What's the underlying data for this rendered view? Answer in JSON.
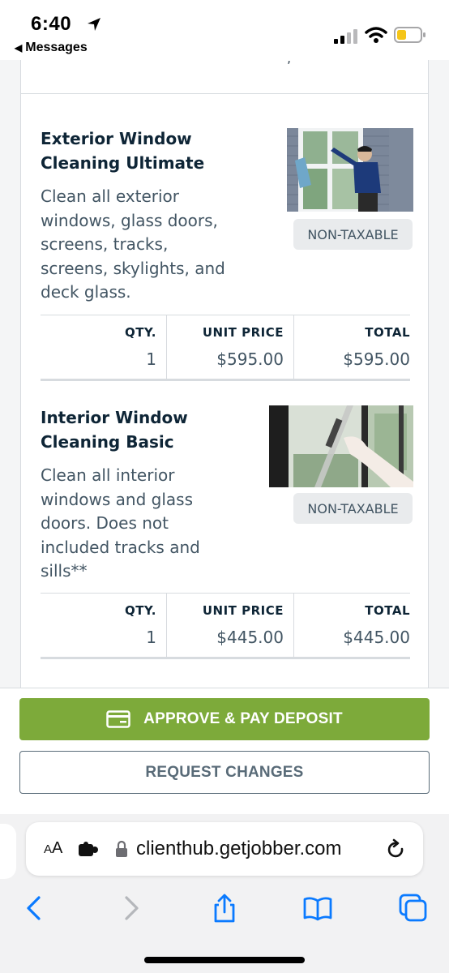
{
  "status_bar": {
    "time": "6:40",
    "back_app": "Messages"
  },
  "line_items": [
    {
      "title": "Exterior Window Cleaning Ultimate",
      "description": "Clean all exterior windows, glass doors, screens, tracks, screens, skylights, and deck glass.",
      "tax_status": "NON-TAXABLE",
      "qty": "1",
      "unit_price": "$595.00",
      "total": "$595.00"
    },
    {
      "title": "Interior Window Cleaning Basic",
      "description": "Clean all interior windows and glass doors. Does not included tracks and sills**",
      "tax_status": "NON-TAXABLE",
      "qty": "1",
      "unit_price": "$445.00",
      "total": "$445.00"
    }
  ],
  "table_headers": {
    "qty": "QTY.",
    "unit_price": "UNIT PRICE",
    "total": "TOTAL"
  },
  "actions": {
    "approve_label": "APPROVE & PAY DEPOSIT",
    "request_label": "REQUEST CHANGES"
  },
  "browser": {
    "aa_label_large": "A",
    "aa_label_small": "A",
    "url": "clienthub.getjobber.com"
  },
  "colors": {
    "approve_green": "#7daa3a",
    "heading_navy": "#0e2536",
    "body_gray": "#425563",
    "ios_blue": "#0a7aff"
  },
  "icons": {
    "location": "location-arrow-icon",
    "signal": "cellular-signal-icon",
    "wifi": "wifi-icon",
    "battery": "battery-icon",
    "card": "credit-card-icon",
    "extension": "extension-icon",
    "lock": "lock-icon",
    "reload": "reload-icon",
    "back": "back-chevron-icon",
    "forward": "forward-chevron-icon",
    "share": "share-icon",
    "bookmarks": "bookmarks-icon",
    "tabs": "tabs-icon"
  }
}
